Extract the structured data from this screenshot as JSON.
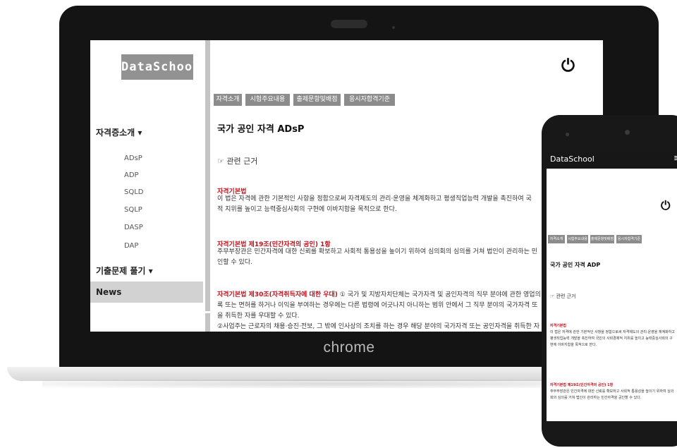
{
  "app": {
    "logo": "DataSchool",
    "browser_label": "chrome"
  },
  "sidebar": {
    "section1": "자격증소개 ▾",
    "items": [
      "ADsP",
      "ADP",
      "SQLD",
      "SQLP",
      "DASP",
      "DAP"
    ],
    "section2": "기출문제 풀기 ▾",
    "news": "News"
  },
  "header": {
    "power_icon": "⏻"
  },
  "tabs": [
    "자격소개",
    "시험주요내용",
    "출제문항및배점",
    "응시자합격기준"
  ],
  "main": {
    "title": "국가 공인 자격 ADsP",
    "subtitle": "☞ 관련 근거",
    "s1_title": "자격기본법",
    "s1_lines": [
      "이 법은 자격에 관한 기본적인 사항을 정함으로써 자격제도의 관리·운영을 체계화하고 평생직업능력 개발을 촉진하여 국",
      "적 지위를 높이고 능력중심사회의 구현에 이바지함을 목적으로 한다."
    ],
    "s2_title": "자격기본법 제19조(민간자격의 공인) 1항",
    "s2_lines": [
      "주무부장관은 민간자격에 대한 신뢰를 확보하고 사회적 통용성을 높이기 위하여 심의회의 심의를 거쳐 법인이 관리하는 민",
      "인할 수 있다."
    ],
    "s3_title": "자격기본법 제30조(자격취득자에 대한 우대)",
    "s3_first": " ① 국가 및 지방자치단체는 국가자격 및 공인자격의 직무 분야에 관한 영업의",
    "s3_lines": [
      "록 또는 면허를 하거나 이익을 부여하는 경우에는 다른 법령에 어긋나지 아니하는 범위 안에서 그 직무 분야의 국가자격 또",
      "을 취득한 자를 우대할 수 있다.",
      "②사업주는 근로자의 채용·승진·전보, 그 밖에 인사상의 조치를 하는 경우 해당 분야의 국가자격 또는 공인자격을 취득한 자"
    ]
  },
  "phone": {
    "logo": "DataSchool",
    "menu_icon": "≡",
    "power_icon": "⏻",
    "tabs": [
      "자격소개",
      "시험주요내용",
      "출제문항및배점",
      "응시자합격기준"
    ],
    "title": "국가 공인 자격 ADP",
    "subtitle": "☞ 관련 근거",
    "s1_title": "자격기본법",
    "s1_lines": [
      "이 법은 자격에 관한 기본적인 사항을 정함으로써 자격제도의 관리·운영을 체계화하고",
      "평생직업능력 개발을 촉진하여 국민의 사회경제적 지위를 높이고 능력중심사회의 구",
      "현에 이바지함을 목적으로 한다."
    ],
    "s2_title": "자격기본법 제19조(민간자격의 공인) 1항",
    "s2_lines": [
      "주무부장관은 민간자격에 대한 신뢰를 확보하고 사회적 통용성을 높이기 위하여 심의",
      "회의 심의를 거쳐 법인이 관리하는 민간자격을 공인할 수 있다."
    ]
  }
}
